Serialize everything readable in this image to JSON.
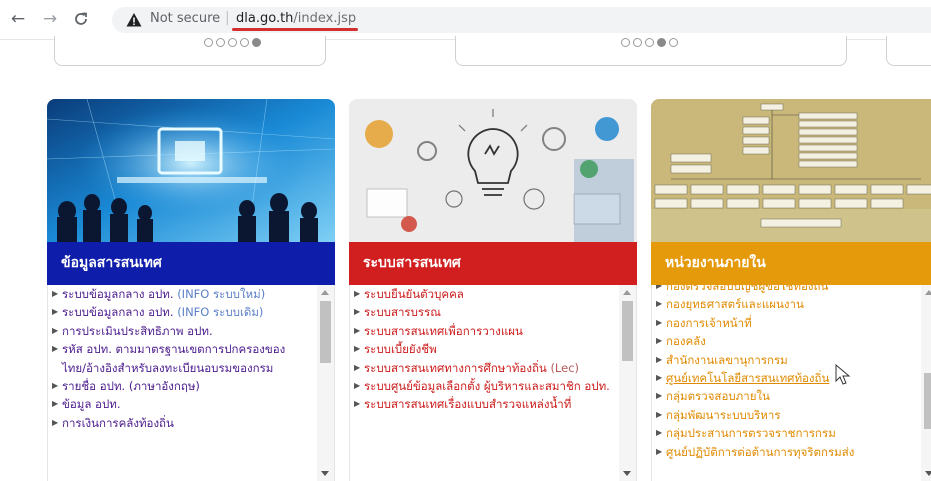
{
  "browser": {
    "security_label": "Not secure",
    "url_host": "dla.go.th",
    "url_path": "/index.jsp",
    "icons": [
      "back-arrow-icon",
      "forward-arrow-icon",
      "reload-icon",
      "warning-triangle-icon"
    ]
  },
  "carousel_dots": [
    {
      "count": 5,
      "active_index": 4
    },
    {
      "count": 5,
      "active_index": 3
    }
  ],
  "cards": [
    {
      "title": "ข้อมูลสารสนเทศ",
      "color": "#0f1eaa",
      "items": [
        {
          "main": "ระบบข้อมูลกลาง อปท. ",
          "extra": "(INFO ระบบใหม่)"
        },
        {
          "main": "ระบบข้อมูลกลาง อปท. ",
          "extra": "(INFO ระบบเดิม)"
        },
        {
          "main": "การประเมินประสิทธิภาพ อปท.",
          "extra": ""
        },
        {
          "main": "รหัส อปท. ตามมาตรฐานเขตการปกครองของไทย/อ้างอิงสำหรับลงทะเบียนอบรมของกรม",
          "extra": ""
        },
        {
          "main": "รายชื่อ อปท. (ภาษาอังกฤษ)",
          "extra": ""
        },
        {
          "main": "ข้อมูล อปท.",
          "extra": ""
        },
        {
          "main": "การเงินการคลังท้องถิ่น",
          "extra": ""
        }
      ]
    },
    {
      "title": "ระบบสารสนเทศ",
      "color": "#d11f1f",
      "items": [
        {
          "main": "ระบบยืนยันตัวบุคคล",
          "extra": ""
        },
        {
          "main": "ระบบสารบรรณ",
          "extra": ""
        },
        {
          "main": "ระบบสารสนเทศเพื่อการวางแผน",
          "extra": ""
        },
        {
          "main": "ระบบเบี้ยยังชีพ",
          "extra": ""
        },
        {
          "main": "ระบบสารสนเทศทางการศึกษาท้องถิ่น ",
          "extra": "(Lec)"
        },
        {
          "main": "ระบบศูนย์ข้อมูลเลือกตั้ง ผู้บริหารและสมาชิก อปท.",
          "extra": ""
        },
        {
          "main": "ระบบสารสนเทศเรื่องแบบสำรวจแหล่งน้ำที่",
          "extra": ""
        }
      ]
    },
    {
      "title": "หน่วยงานภายใน",
      "color": "#e59a0c",
      "items": [
        {
          "main": "กองตรวจสอบบัญชีผู้ขอใช้ท้องถิ่น",
          "extra": ""
        },
        {
          "main": "กองยุทธศาสตร์และแผนงาน",
          "extra": ""
        },
        {
          "main": "กองการเจ้าหน้าที่",
          "extra": ""
        },
        {
          "main": "กองคลัง",
          "extra": ""
        },
        {
          "main": "สำนักงานเลขานุการกรม",
          "extra": ""
        },
        {
          "main": "ศูนย์เทคโนโลยีสารสนเทศท้องถิ่น",
          "extra": ""
        },
        {
          "main": "กลุ่มตรวจสอบภายใน",
          "extra": ""
        },
        {
          "main": "กลุ่มพัฒนาระบบบริหาร",
          "extra": ""
        },
        {
          "main": "กลุ่มประสานการตรวจราชการกรม",
          "extra": ""
        },
        {
          "main": "ศูนย์ปฏิบัติการต่อต้านการทุจริตกรมส่ง",
          "extra": ""
        }
      ],
      "active_item": 5
    }
  ]
}
